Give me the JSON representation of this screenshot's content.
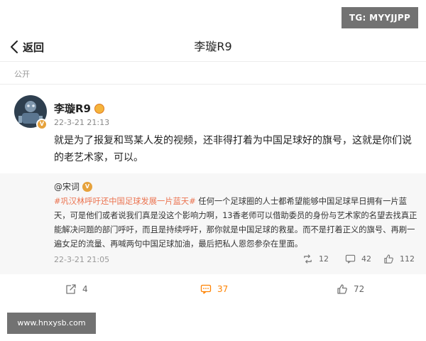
{
  "watermarks": {
    "top": "TG: MYYJJPP",
    "bottom": "www.hnxysb.com"
  },
  "nav": {
    "back_label": "返回",
    "title": "李璇R9"
  },
  "visibility": "公开",
  "post": {
    "author": "李璇R9",
    "time": "22-3-21 21:13",
    "text": "就是为了报复和骂某人发的视频，还非得打着为中国足球好的旗号，这就是你们说的老艺术家，可以。"
  },
  "repost": {
    "author": "@宋词",
    "topic": "#巩汉林呼吁还中国足球发展一片蓝天#",
    "text": " 任何一个足球圈的人士都希望能够中国足球早日拥有一片蓝天，可是他们或者说我们真是没这个影响力啊，13香老师可以借助委员的身份与艺术家的名望去找真正能解决问题的部门呼吁，而且是持续呼吁，那你就是中国足球的救星。而不是打着正义的旗号、再刷一遍女足的流量、再喊两句中国足球加油，最后把私人恩怨参杂在里面。",
    "time": "22-3-21 21:05",
    "reposts": "12",
    "comments": "42",
    "likes": "112"
  },
  "actions": {
    "reposts": "4",
    "comments": "37",
    "likes": "72"
  },
  "colors": {
    "accent": "#ff8200",
    "topic": "#eb7350",
    "repost_bg": "#f7f7f7"
  }
}
